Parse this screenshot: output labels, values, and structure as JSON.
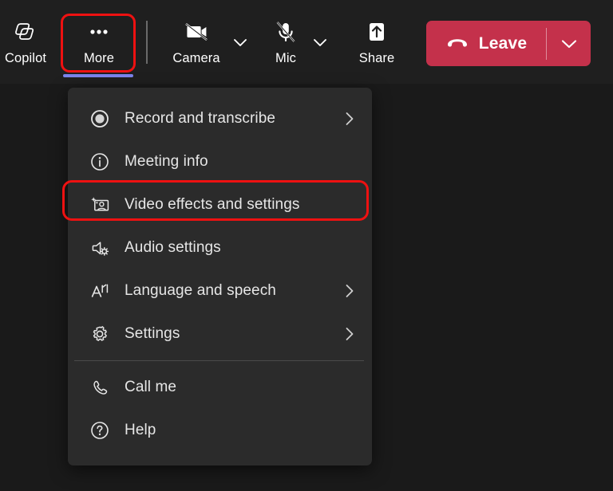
{
  "theme": {
    "toolbar_bg": "#1f1f1f",
    "menu_bg": "#2b2b2b",
    "page_bg": "#1a1a1a",
    "leave_red": "#c4314b",
    "annotation_red": "#ee1111",
    "active_underline": "#7b83eb",
    "text_primary": "#ffffff",
    "menu_text": "#e6e6e6"
  },
  "toolbar": {
    "buttons": [
      {
        "id": "copilot",
        "label": "Copilot",
        "icon": "copilot-icon",
        "state": "normal"
      },
      {
        "id": "more",
        "label": "More",
        "icon": "more-ellipsis-icon",
        "state": "active"
      },
      {
        "id": "camera",
        "label": "Camera",
        "icon": "camera-off-icon",
        "state": "off"
      },
      {
        "id": "mic",
        "label": "Mic",
        "icon": "mic-off-icon",
        "state": "off"
      },
      {
        "id": "share",
        "label": "Share",
        "icon": "share-screen-icon",
        "state": "normal"
      }
    ],
    "camera_caret": {
      "icon": "chevron-down-icon",
      "label": "Camera options"
    },
    "mic_caret": {
      "icon": "chevron-down-icon",
      "label": "Mic options"
    },
    "leave": {
      "label": "Leave",
      "icon": "hangup-phone-icon",
      "caret_icon": "chevron-down-icon"
    }
  },
  "menu": {
    "groups": [
      {
        "items": [
          {
            "label": "Record and transcribe",
            "icon": "record-circle-icon",
            "submenu": true,
            "highlighted": false
          },
          {
            "label": "Meeting info",
            "icon": "info-circle-icon",
            "submenu": false,
            "highlighted": false
          },
          {
            "label": "Video effects and settings",
            "icon": "video-effects-icon",
            "submenu": false,
            "highlighted": true
          },
          {
            "label": "Audio settings",
            "icon": "speaker-gear-icon",
            "submenu": false,
            "highlighted": false
          },
          {
            "label": "Language and speech",
            "icon": "translate-icon",
            "submenu": true,
            "highlighted": false
          },
          {
            "label": "Settings",
            "icon": "gear-icon",
            "submenu": true,
            "highlighted": false
          }
        ]
      },
      {
        "items": [
          {
            "label": "Call me",
            "icon": "phone-handset-icon",
            "submenu": false,
            "highlighted": false
          },
          {
            "label": "Help",
            "icon": "help-circle-icon",
            "submenu": false,
            "highlighted": false
          }
        ]
      }
    ]
  },
  "annotations": [
    {
      "target": "more-button",
      "shape": "rounded-rect",
      "color": "#ee1111"
    },
    {
      "target": "menu-item-video-effects-and-settings",
      "shape": "rounded-rect",
      "color": "#ee1111"
    }
  ]
}
